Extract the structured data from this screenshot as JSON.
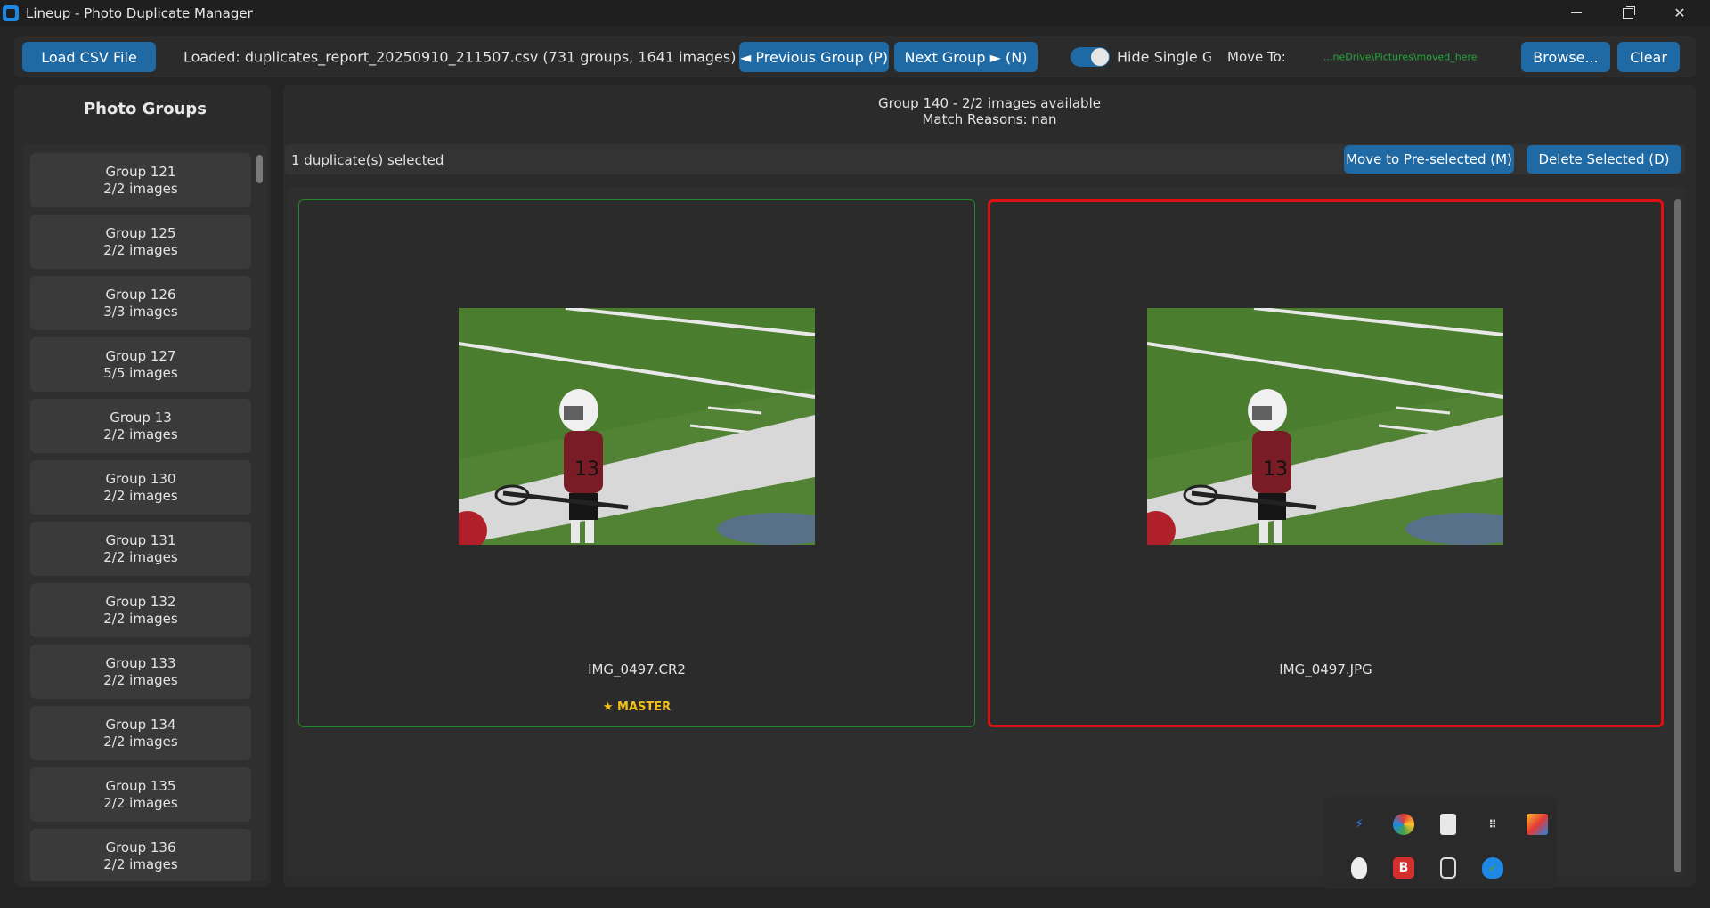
{
  "window": {
    "title": "Lineup - Photo Duplicate Manager"
  },
  "toolbar": {
    "load_button": "Load CSV File",
    "loaded_text": "Loaded: duplicates_report_20250910_211507.csv (731 groups, 1641 images)",
    "prev_button": "◄ Previous Group (P)",
    "next_button": "Next Group ► (N)",
    "hide_single_label": "Hide Single Groups",
    "hide_single_on": true,
    "move_to_label": "Move To:",
    "move_to_path": "...neDrive\\Pictures\\moved_here",
    "browse_button": "Browse...",
    "clear_button": "Clear"
  },
  "sidebar": {
    "title": "Photo Groups",
    "groups": [
      {
        "name": "Group 121",
        "count": "2/2 images"
      },
      {
        "name": "Group 125",
        "count": "2/2 images"
      },
      {
        "name": "Group 126",
        "count": "3/3 images"
      },
      {
        "name": "Group 127",
        "count": "5/5 images"
      },
      {
        "name": "Group 13",
        "count": "2/2 images"
      },
      {
        "name": "Group 130",
        "count": "2/2 images"
      },
      {
        "name": "Group 131",
        "count": "2/2 images"
      },
      {
        "name": "Group 132",
        "count": "2/2 images"
      },
      {
        "name": "Group 133",
        "count": "2/2 images"
      },
      {
        "name": "Group 134",
        "count": "2/2 images"
      },
      {
        "name": "Group 135",
        "count": "2/2 images"
      },
      {
        "name": "Group 136",
        "count": "2/2 images"
      }
    ]
  },
  "main": {
    "group_title": "Group 140 - 2/2 images available",
    "match_reasons": "Match Reasons: nan",
    "selection_text": "1 duplicate(s) selected",
    "move_button": "Move to Pre-selected (M)",
    "delete_button": "Delete Selected (D)",
    "images": [
      {
        "filename": "IMG_0497.CR2",
        "badge": "★ MASTER",
        "selected": false
      },
      {
        "filename": "IMG_0497.JPG",
        "badge": "",
        "selected": true
      }
    ]
  },
  "tray": {
    "icons": [
      "lightning-icon",
      "color-wheel-icon",
      "bag-icon",
      "dots-grid-icon",
      "palette-icon",
      "shield-icon",
      "bitdefender-icon",
      "usb-device-icon",
      "defender-icon"
    ]
  },
  "colors": {
    "accent": "#1f6aa5",
    "master_border": "#1f8a2a",
    "selected_border": "#e01010",
    "badge": "#f2c21a"
  }
}
